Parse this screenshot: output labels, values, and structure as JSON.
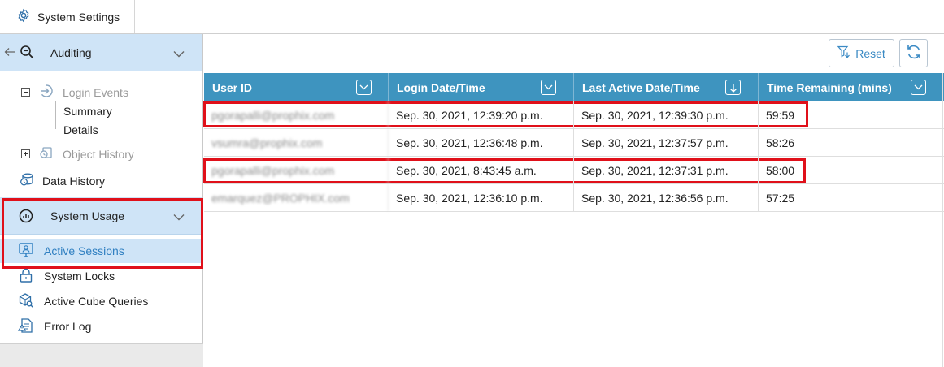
{
  "header": {
    "title": "System Settings",
    "icon": "gear-icon"
  },
  "sidebar": {
    "auditing": {
      "label": "Auditing",
      "items": [
        {
          "label": "Login Events",
          "icon": "login-arrow-icon",
          "expander": "minus"
        },
        {
          "label": "Summary"
        },
        {
          "label": "Details"
        },
        {
          "label": "Object History",
          "icon": "history-icon",
          "expander": "plus"
        },
        {
          "label": "Data History",
          "icon": "data-history-icon"
        }
      ]
    },
    "system_usage": {
      "label": "System Usage",
      "items": [
        {
          "label": "Active Sessions",
          "icon": "monitor-user-icon",
          "active": true
        },
        {
          "label": "System Locks",
          "icon": "lock-icon"
        },
        {
          "label": "Active Cube Queries",
          "icon": "cube-search-icon"
        },
        {
          "label": "Error Log",
          "icon": "error-log-icon"
        }
      ]
    }
  },
  "toolbar": {
    "reset_label": "Reset"
  },
  "grid": {
    "columns": [
      {
        "label": "User ID"
      },
      {
        "label": "Login Date/Time"
      },
      {
        "label": "Last Active Date/Time",
        "sorted": "descending"
      },
      {
        "label": "Time Remaining (mins)"
      }
    ],
    "rows": [
      {
        "user": "pgorapalli@prophix.com",
        "login": "Sep. 30, 2021, 12:39:20 p.m.",
        "last": "Sep. 30, 2021, 12:39:30 p.m.",
        "remaining": "59:59"
      },
      {
        "user": "vsumra@prophix.com",
        "login": "Sep. 30, 2021, 12:36:48 p.m.",
        "last": "Sep. 30, 2021, 12:37:57 p.m.",
        "remaining": "58:26"
      },
      {
        "user": "pgorapalli@prophix.com",
        "login": "Sep. 30, 2021, 8:43:45 a.m.",
        "last": "Sep. 30, 2021, 12:37:31 p.m.",
        "remaining": "58:00"
      },
      {
        "user": "emarquez@PROPHIX.com",
        "login": "Sep. 30, 2021, 12:36:10 p.m.",
        "last": "Sep. 30, 2021, 12:36:56 p.m.",
        "remaining": "57:25"
      }
    ]
  },
  "colors": {
    "accent": "#3e94bf",
    "highlight_bg": "#cfe4f7",
    "annotation_red": "#e0101a"
  }
}
